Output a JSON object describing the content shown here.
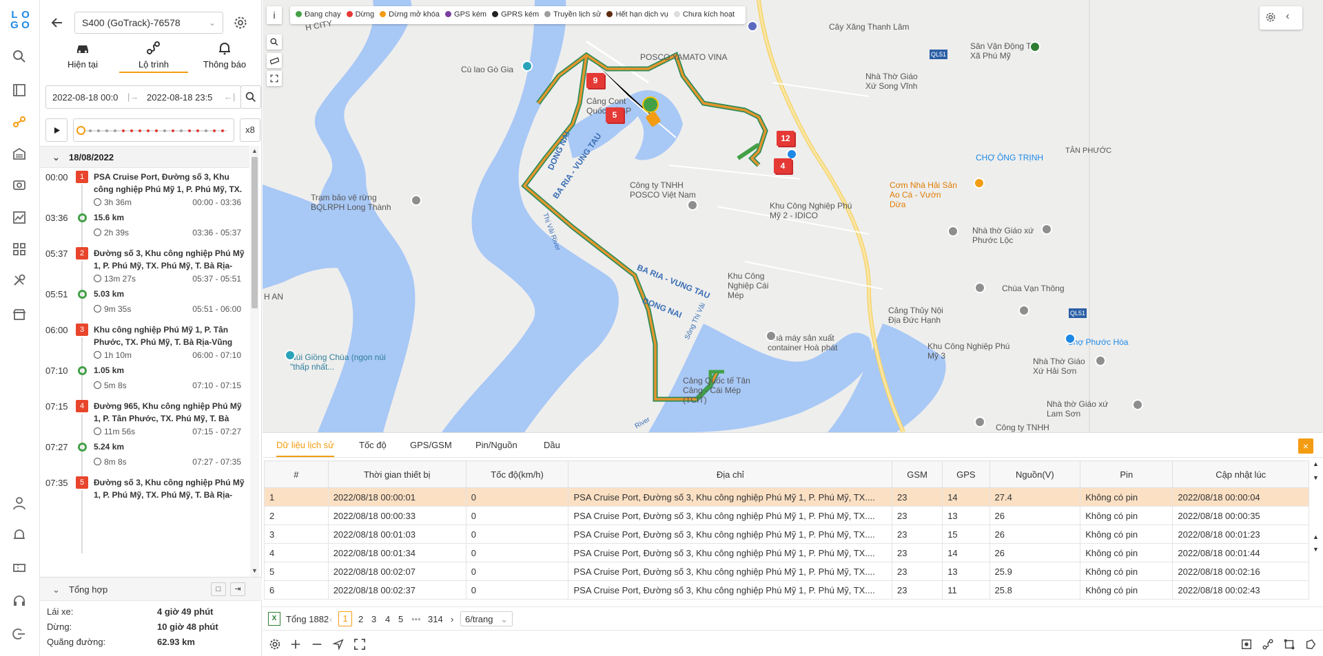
{
  "brand": {
    "logo_letters": [
      "L",
      "O",
      "G",
      "O"
    ],
    "accent": "#f39c12",
    "primary": "#1e88e5"
  },
  "rail": {
    "top_icons": [
      "search-icon",
      "book-icon",
      "route-icon",
      "garage-icon",
      "camera-icon",
      "chart-icon",
      "apps-icon",
      "tools-icon",
      "store-icon"
    ],
    "bottom_icons": [
      "user-icon",
      "bell-icon",
      "ticket-icon",
      "headset-icon",
      "logout-icon"
    ]
  },
  "panel": {
    "vehicle": "S400 (GoTrack)-76578",
    "tabs": [
      {
        "label": "Hiện tại",
        "icon": "car-icon"
      },
      {
        "label": "Lộ trình",
        "icon": "route-icon"
      },
      {
        "label": "Thông báo",
        "icon": "bell-icon"
      }
    ],
    "date_start": "2022-08-18 00:0",
    "date_end": "2022-08-18 23:5",
    "speed": "x8",
    "list_date": "18/08/2022",
    "trips": [
      {
        "kind": "stop",
        "time": "00:00",
        "num": "1",
        "text": "PSA Cruise Port, Đường số 3, Khu công nghiệp Phú Mỹ 1, P. Phú Mỹ, TX.",
        "dur": "3h 36m",
        "range": "00:00 - 03:36"
      },
      {
        "kind": "move",
        "time": "03:36",
        "km": "15.6 km",
        "dur": "2h 39s",
        "range": "03:36 - 05:37"
      },
      {
        "kind": "stop",
        "time": "05:37",
        "num": "2",
        "text": "Đường số 3, Khu công nghiệp Phú Mỹ 1, P. Phú Mỹ, TX. Phú Mỹ, T. Bà Rịa-",
        "dur": "13m 27s",
        "range": "05:37 - 05:51"
      },
      {
        "kind": "move",
        "time": "05:51",
        "km": "5.03 km",
        "dur": "9m 35s",
        "range": "05:51 - 06:00"
      },
      {
        "kind": "stop",
        "time": "06:00",
        "num": "3",
        "text": "Khu công nghiệp Phú Mỹ 1, P. Tân Phước, TX. Phú Mỹ, T. Bà Rịa-Vũng",
        "dur": "1h 10m",
        "range": "06:00 - 07:10"
      },
      {
        "kind": "move",
        "time": "07:10",
        "km": "1.05 km",
        "dur": "5m 8s",
        "range": "07:10 - 07:15"
      },
      {
        "kind": "stop",
        "time": "07:15",
        "num": "4",
        "text": "Đường 965, Khu công nghiệp Phú Mỹ 1, P. Tân Phước, TX. Phú Mỹ, T. Bà",
        "dur": "11m 56s",
        "range": "07:15 - 07:27"
      },
      {
        "kind": "move",
        "time": "07:27",
        "km": "5.24 km",
        "dur": "8m 8s",
        "range": "07:27 - 07:35"
      },
      {
        "kind": "stop",
        "time": "07:35",
        "num": "5",
        "text": "Đường số 3, Khu công nghiệp Phú Mỹ 1, P. Phú Mỹ, TX. Phú Mỹ, T. Bà Rịa-",
        "dur": "",
        "range": ""
      }
    ],
    "summary": {
      "title": "Tổng hợp",
      "rows": [
        {
          "label": "Lái xe:",
          "value": "4 giờ 49 phút"
        },
        {
          "label": "Dừng:",
          "value": "10 giờ 48 phút"
        },
        {
          "label": "Quãng đường:",
          "value": "62.93 km"
        }
      ]
    }
  },
  "map": {
    "legend": [
      {
        "label": "Đang chạy",
        "color": "#43a047"
      },
      {
        "label": "Dừng",
        "color": "#e53935"
      },
      {
        "label": "Dừng mở khóa",
        "color": "#f39c12"
      },
      {
        "label": "GPS kém",
        "color": "#7b3fa0"
      },
      {
        "label": "GPRS kém",
        "color": "#222222"
      },
      {
        "label": "Truyền lịch sử",
        "color": "#9e9e9e"
      },
      {
        "label": "Hết hạn dịch vụ",
        "color": "#5d2b0f"
      },
      {
        "label": "Chưa kích hoạt",
        "color": "#dddddd"
      }
    ],
    "info": "i",
    "places": {
      "cay_xang": "Cây Xăng Thanh Lâm",
      "san_van_dong": "Sân Vận Động Thị Xã Phú Mỹ",
      "cu_lao": "Cù lao Gò Gia",
      "posco_yamato": "POSCO YAMATO VINA",
      "nha_tho_song_vinh": "Nhà Thờ Giáo Xứ Song Vĩnh",
      "ql51_a": "QL51",
      "cang_cont": "Cảng Cont Quốc Tế SP",
      "dong_nai_1": "DONG NAI",
      "ba_ria_1": "BA RIA - VUNG TAU",
      "cho_ong_trinh": "CHỢ ÔNG TRỊNH",
      "tan_phuoc": "TÂN PHƯỚC",
      "com_hai_san": "Cơm Nhà Hải Sản Ao Cá - Vườn Dừa",
      "posco_vn": "Công ty TNHH POSCO Việt Nam",
      "tram_bao_ve": "Trạm bảo vệ rừng BQLRPH Long Thành",
      "kcn_phu_my_2": "Khu Công Nghiệp Phú Mỹ 2 - IDICO",
      "nha_tho_phuoc_loc": "Nhà thờ Giáo xứ Phước Lộc",
      "thi_vai_1": "Thị Vải River",
      "ba_ria_2": "BA RIA - VUNG TAU",
      "dong_nai_2": "DONG NAI",
      "song_thi_vai": "Sông Thị Vải",
      "kcn_cai_mep": "Khu Công Nghiệp Cái Mép",
      "chua_van_thong": "Chùa Vạn Thông",
      "cang_thuy_noi": "Cảng Thủy Nội Địa Đức Hạnh",
      "ql51_b": "QL51",
      "nui_giong_chua": "Núi Giồng Chùa (ngọn núi \"thấp nhất...",
      "nha_may": "Nhà máy sản xuất container Hoà phát",
      "kcn_phu_my_3": "Khu Công Nghiệp Phú Mỹ 3",
      "cho_phuoc_hoa": "Chợ Phước Hòa",
      "nha_tho_hai_son": "Nhà Thờ Giáo Xứ Hải Sơn",
      "cang_cai_mep": "Cảng Quốc tế Tân Cảng - Cái Mép (TCIT)",
      "nha_tho_lam_son": "Nhà thờ Giáo xứ Lam Sơn",
      "cong_ty_tnhh": "Công ty TNHH",
      "river_b": "River",
      "h_city": "H CITY",
      "h_an": "H AN"
    },
    "flags": [
      "9",
      "5",
      "12",
      "4"
    ]
  },
  "bottom": {
    "tabs": [
      "Dữ liệu lịch sử",
      "Tốc độ",
      "GPS/GSM",
      "Pin/Nguồn",
      "Dầu"
    ],
    "close": "×",
    "columns": [
      "#",
      "Thời gian thiết bị",
      "Tốc độ(km/h)",
      "Địa chỉ",
      "GSM",
      "GPS",
      "Nguồn(V)",
      "Pin",
      "Cập nhật lúc"
    ],
    "rows": [
      [
        "1",
        "2022/08/18 00:00:01",
        "0",
        "PSA Cruise Port, Đường số 3, Khu công nghiệp Phú Mỹ 1, P. Phú Mỹ, TX....",
        "23",
        "14",
        "27.4",
        "Không có pin",
        "2022/08/18 00:00:04"
      ],
      [
        "2",
        "2022/08/18 00:00:33",
        "0",
        "PSA Cruise Port, Đường số 3, Khu công nghiệp Phú Mỹ 1, P. Phú Mỹ, TX....",
        "23",
        "13",
        "26",
        "Không có pin",
        "2022/08/18 00:00:35"
      ],
      [
        "3",
        "2022/08/18 00:01:03",
        "0",
        "PSA Cruise Port, Đường số 3, Khu công nghiệp Phú Mỹ 1, P. Phú Mỹ, TX....",
        "23",
        "15",
        "26",
        "Không có pin",
        "2022/08/18 00:01:23"
      ],
      [
        "4",
        "2022/08/18 00:01:34",
        "0",
        "PSA Cruise Port, Đường số 3, Khu công nghiệp Phú Mỹ 1, P. Phú Mỹ, TX....",
        "23",
        "14",
        "26",
        "Không có pin",
        "2022/08/18 00:01:44"
      ],
      [
        "5",
        "2022/08/18 00:02:07",
        "0",
        "PSA Cruise Port, Đường số 3, Khu công nghiệp Phú Mỹ 1, P. Phú Mỹ, TX....",
        "23",
        "13",
        "25.9",
        "Không có pin",
        "2022/08/18 00:02:16"
      ],
      [
        "6",
        "2022/08/18 00:02:37",
        "0",
        "PSA Cruise Port, Đường số 3, Khu công nghiệp Phú Mỹ 1, P. Phú Mỹ, TX....",
        "23",
        "11",
        "25.8",
        "Không có pin",
        "2022/08/18 00:02:43"
      ]
    ],
    "pager": {
      "total": "Tổng 1882",
      "pages": [
        "1",
        "2",
        "3",
        "4",
        "5",
        "•••",
        "314"
      ],
      "page_size": "6/trang"
    }
  }
}
